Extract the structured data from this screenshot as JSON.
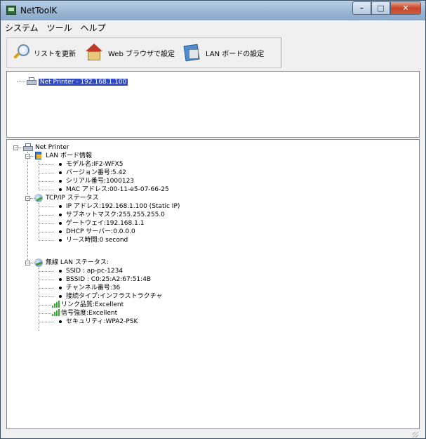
{
  "window": {
    "title": "NetToolK"
  },
  "menu": [
    "システム",
    "ツール",
    "ヘルプ"
  ],
  "toolbar": [
    {
      "label": "リストを更新",
      "icon": "magnifier-icon"
    },
    {
      "label": "Web ブラウザで設定",
      "icon": "house-icon"
    },
    {
      "label": "LAN ボードの設定",
      "icon": "board-icon"
    }
  ],
  "device_list": {
    "items": [
      "Net Printer - 192.168.1.100"
    ]
  },
  "tree": {
    "root": "Net Printer",
    "lan_board": {
      "title": "LAN ボード情報",
      "items": [
        "モデル名:IF2-WFX5",
        "バージョン番号:5.42",
        "シリアル番号:1000123",
        "MAC アドレス:00-11-e5-07-66-25"
      ]
    },
    "tcpip": {
      "title": "TCP/IP ステータス",
      "items": [
        "IP アドレス:192.168.1.100 (Static IP)",
        "サブネットマスク:255.255.255.0",
        "ゲートウェイ:192.168.1.1",
        "DHCP サーバー:0.0.0.0",
        "リース時間:0 second"
      ]
    },
    "wireless": {
      "title": "無線 LAN ステータス:",
      "items": [
        "SSID : ap-pc-1234",
        "BSSID : C0:25:A2:67:51:4B",
        "チャンネル番号:36",
        "接続タイプ:インフラストラクチャ",
        "リンク品質:Excellent",
        "信号強度:Excellent",
        "セキュリティ:WPA2-PSK"
      ]
    }
  }
}
